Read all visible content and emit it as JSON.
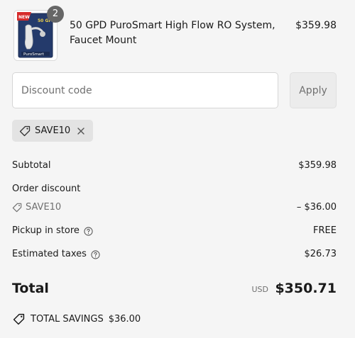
{
  "product": {
    "name": "50 GPD PuroSmart High Flow RO System, Faucet Mount",
    "price": "$359.98",
    "quantity_badge": "2",
    "image_new_label": "NEW",
    "image_brand_label": "PuroSmart",
    "image_box_text": "50 GPD"
  },
  "discount": {
    "placeholder": "Discount code",
    "apply_label": "Apply",
    "applied_code": "SAVE10"
  },
  "summary": {
    "subtotal_label": "Subtotal",
    "subtotal_value": "$359.98",
    "order_discount_label": "Order discount",
    "discount_code": "SAVE10",
    "discount_value": "– $36.00",
    "pickup_label": "Pickup in store",
    "pickup_value": "FREE",
    "taxes_label": "Estimated taxes",
    "taxes_value": "$26.73",
    "total_label": "Total",
    "total_currency": "USD",
    "total_value": "$350.71",
    "savings_label": "TOTAL SAVINGS",
    "savings_value": "$36.00"
  },
  "colors": {
    "background": "#f5f5f5",
    "muted_text": "#707070",
    "badge": "#666666"
  }
}
